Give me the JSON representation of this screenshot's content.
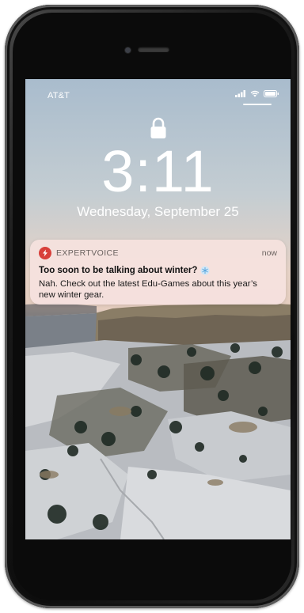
{
  "status_bar": {
    "carrier": "AT&T",
    "signal_icon": "signal-bars-icon",
    "wifi_icon": "wifi-icon",
    "battery_icon": "battery-icon"
  },
  "lock_screen": {
    "lock_icon": "padlock-icon",
    "time": "3:11",
    "date": "Wednesday, September 25"
  },
  "notification": {
    "app_icon": "lightning-bolt-icon",
    "app_name": "EXPERTVOICE",
    "time": "now",
    "title": "Too soon to be talking about winter?",
    "title_emoji": "snowflake-icon",
    "body": "Nah. Check out the latest Edu-Games about this year’s new winter gear."
  },
  "colors": {
    "app_accent": "#d8403b",
    "notification_bg": "#f5e1de",
    "device_frame": "#1a1a1a"
  }
}
